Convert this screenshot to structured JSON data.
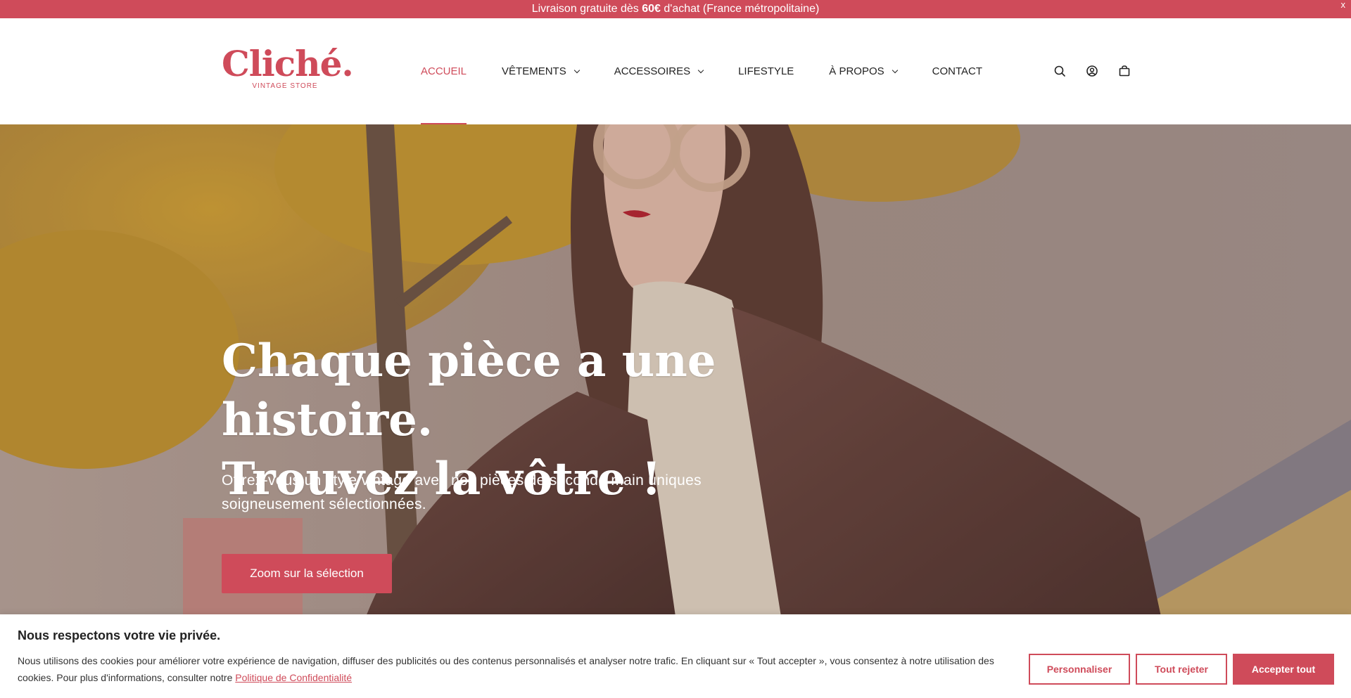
{
  "announcement": {
    "prefix": "Livraison gratuite dès ",
    "amount": "60€",
    "suffix": " d'achat (France métropolitaine)",
    "close": "x"
  },
  "brand": {
    "name": "Cliché.",
    "tagline": "VINTAGE STORE",
    "color": "#cf4b5a"
  },
  "nav": {
    "items": [
      {
        "label": "ACCUEIL",
        "active": true,
        "dropdown": false
      },
      {
        "label": "VÊTEMENTS",
        "active": false,
        "dropdown": true
      },
      {
        "label": "ACCESSOIRES",
        "active": false,
        "dropdown": true
      },
      {
        "label": "LIFESTYLE",
        "active": false,
        "dropdown": false
      },
      {
        "label": "À PROPOS",
        "active": false,
        "dropdown": true
      },
      {
        "label": "CONTACT",
        "active": false,
        "dropdown": false
      }
    ]
  },
  "header_icons": [
    "search-icon",
    "account-icon",
    "cart-icon"
  ],
  "hero": {
    "title_line1": "Chaque pièce a une histoire.",
    "title_line2": "Trouvez la vôtre !",
    "subtitle": "Offrez-vous un style vintage avec nos pièces de seconde main uniques soigneusement sélectionnées.",
    "cta": "Zoom sur la sélection"
  },
  "cookie": {
    "title": "Nous respectons votre vie privée.",
    "text": "Nous utilisons des cookies pour améliorer votre expérience de navigation, diffuser des publicités ou des contenus personnalisés et analyser notre trafic. En cliquant sur « Tout accepter », vous consentez à notre utilisation des cookies. Pour plus d'informations, consulter notre ",
    "link": "Politique de Confidentialité",
    "buttons": {
      "customize": "Personnaliser",
      "reject": "Tout rejeter",
      "accept": "Accepter tout"
    }
  }
}
